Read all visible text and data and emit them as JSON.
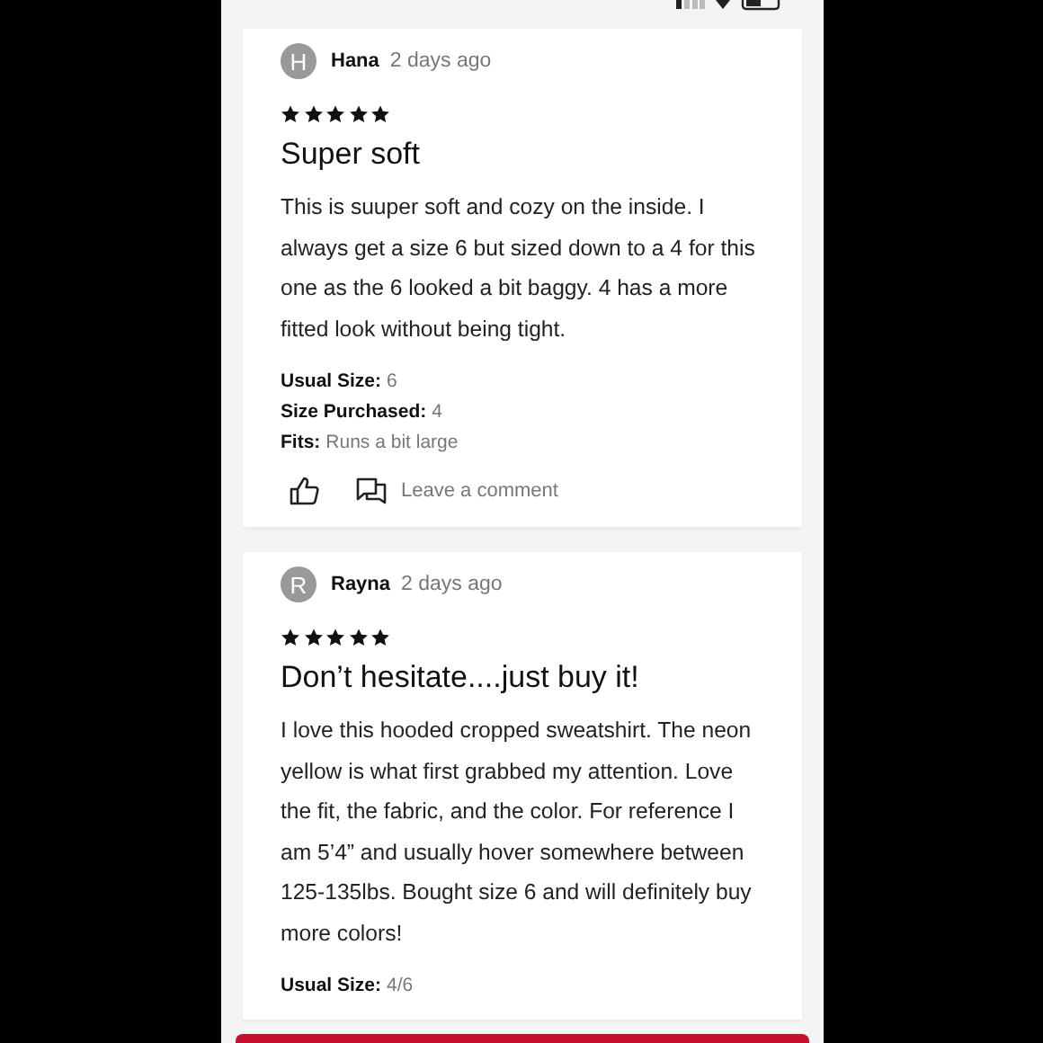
{
  "reviews": [
    {
      "initial": "H",
      "author": "Hana",
      "date": "2 days ago",
      "stars": 5,
      "title": "Super soft",
      "body": [
        "This is suuper soft and cozy on the inside. I always get a size 6 but sized down to a 4 for this one as the 6 looked a bit baggy. 4 has a more fitted look without being tight."
      ],
      "details": [
        {
          "label": "Usual Size:",
          "value": "6"
        },
        {
          "label": "Size Purchased:",
          "value": "4"
        },
        {
          "label": "Fits:",
          "value": "Runs a bit large"
        }
      ],
      "comment_link": "Leave a comment"
    },
    {
      "initial": "R",
      "author": "Rayna",
      "date": "2 days ago",
      "stars": 5,
      "title": "Don’t hesitate....just buy it!",
      "body": [
        "I love this hooded cropped sweatshirt. The neon yellow is what first grabbed my attention. Love the fit, the fabric, and the color. For reference I am 5’4” and usually hover somewhere between 125-135lbs. Bought size 6 and will definitely buy more colors!"
      ],
      "details": [
        {
          "label": "Usual Size:",
          "value": "4/6"
        }
      ]
    }
  ]
}
